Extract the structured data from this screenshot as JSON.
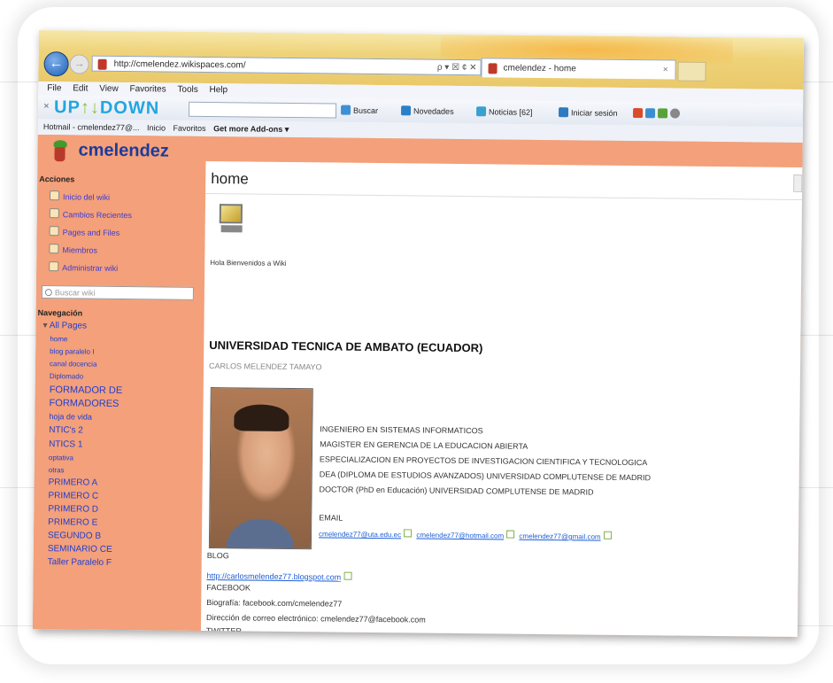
{
  "browser": {
    "url": "http://cmelendez.wikispaces.com/",
    "address_controls": "ρ ▾ ☒ ¢ ✕",
    "tab_title": "cmelendez - home",
    "tab_close": "×",
    "menu": [
      "File",
      "Edit",
      "View",
      "Favorites",
      "Tools",
      "Help"
    ],
    "toolbar": {
      "close": "×",
      "logo_a": "UP",
      "logo_b": "DOWN",
      "buscar": "Buscar",
      "novedades": "Novedades",
      "noticias": "Noticias [62]",
      "iniciar_sesion": "Iniciar sesión"
    },
    "favorites": [
      "Hotmail - cmelendez77@...",
      "Inicio",
      "Favoritos",
      "Get more Add-ons ▾"
    ]
  },
  "wiki": {
    "name": "cmelendez",
    "acciones_title": "Acciones",
    "acciones": [
      "Inicio del wiki",
      "Cambios Recientes",
      "Pages and Files",
      "Miembros",
      "Administrar wiki"
    ],
    "search_placeholder": "Buscar wiki",
    "navegacion_title": "Navegación",
    "all_pages": "All Pages",
    "pages": [
      "home",
      "blog paralelo I",
      "canal docencia",
      "Diplomado",
      "FORMADOR DE",
      "FORMADORES",
      "hoja de vida",
      "NTIC's 2",
      "NTICS 1",
      "optativa",
      "otras",
      "PRIMERO A",
      "PRIMERO C",
      "PRIMERO D",
      "PRIMERO E",
      "SEGUNDO B",
      "SEMINARIO CE",
      "Taller Paralelo F"
    ]
  },
  "content": {
    "page_title": "home",
    "welcome": "Hola Bienvenidos a Wiki",
    "university": "UNIVERSIDAD TECNICA DE AMBATO (ECUADOR)",
    "author": "CARLOS MELENDEZ TAMAYO",
    "credentials": [
      "INGENIERO EN SISTEMAS INFORMATICOS",
      "MAGISTER EN GERENCIA DE LA EDUCACION ABIERTA",
      "ESPECIALIZACION EN PROYECTOS DE INVESTIGACION CIENTIFICA Y TECNOLOGICA",
      "DEA (DIPLOMA DE ESTUDIOS AVANZADOS) UNIVERSIDAD COMPLUTENSE DE MADRID",
      "DOCTOR (PhD en Educación) UNIVERSIDAD COMPLUTENSE DE MADRID"
    ],
    "email_label": "EMAIL",
    "emails": [
      "cmelendez77@uta.edu.ec",
      "cmelendez77@hotmail.com",
      "cmelendez77@gmail.com"
    ],
    "blog_label": "BLOG",
    "blog_url": "http://carlosmelendez77.blogspot.com",
    "facebook_label": "FACEBOOK",
    "biografia": "Biografía: facebook.com/cmelendez77",
    "correo": "Dirección de correo electrónico: cmelendez77@facebook.com",
    "twitter_label": "TWITTER"
  }
}
